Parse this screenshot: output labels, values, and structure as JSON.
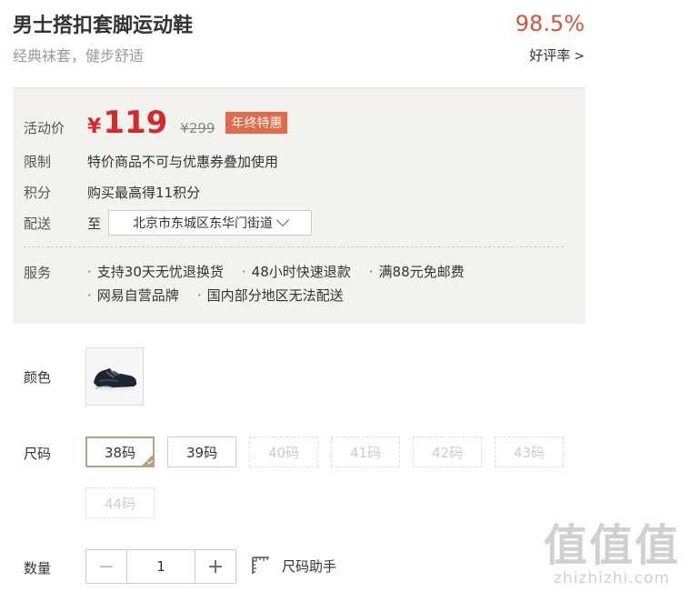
{
  "product": {
    "title": "男士搭扣套脚运动鞋",
    "subtitle": "经典袜套，健步舒适"
  },
  "rating": {
    "value": "98.5%",
    "link_label": "好评率",
    "arrow": ">"
  },
  "price": {
    "label": "活动价",
    "currency": "¥",
    "current": "119",
    "original": "¥299",
    "promo_tag": "年终特惠"
  },
  "limit": {
    "label": "限制",
    "text": "特价商品不可与优惠券叠加使用"
  },
  "points": {
    "label": "积分",
    "text": "购买最高得11积分"
  },
  "shipping": {
    "label": "配送",
    "to": "至",
    "address": "北京市东城区东华门街道"
  },
  "services": {
    "label": "服务",
    "items": [
      "支持30天无忧退换货",
      "48小时快速退款",
      "满88元免邮费",
      "网易自营品牌",
      "国内部分地区无法配送"
    ]
  },
  "color": {
    "label": "颜色",
    "swatch_icon": "black-sneaker-thumbnail"
  },
  "size": {
    "label": "尺码",
    "options": [
      {
        "label": "38码",
        "state": "selected"
      },
      {
        "label": "39码",
        "state": "available"
      },
      {
        "label": "40码",
        "state": "disabled"
      },
      {
        "label": "41码",
        "state": "disabled"
      },
      {
        "label": "42码",
        "state": "disabled"
      },
      {
        "label": "43码",
        "state": "disabled"
      },
      {
        "label": "44码",
        "state": "disabled"
      }
    ]
  },
  "quantity": {
    "label": "数量",
    "minus": "−",
    "value": "1",
    "plus": "+",
    "size_help": "尺码助手"
  },
  "watermark": {
    "big": "值值值",
    "small": "zhizhizhi.com"
  },
  "colors": {
    "price": "#d22b2b",
    "promo": "#e4694a",
    "rating": "#d4553b",
    "selected_border": "#b8a17a",
    "panel_bg": "#f4f2ef"
  }
}
